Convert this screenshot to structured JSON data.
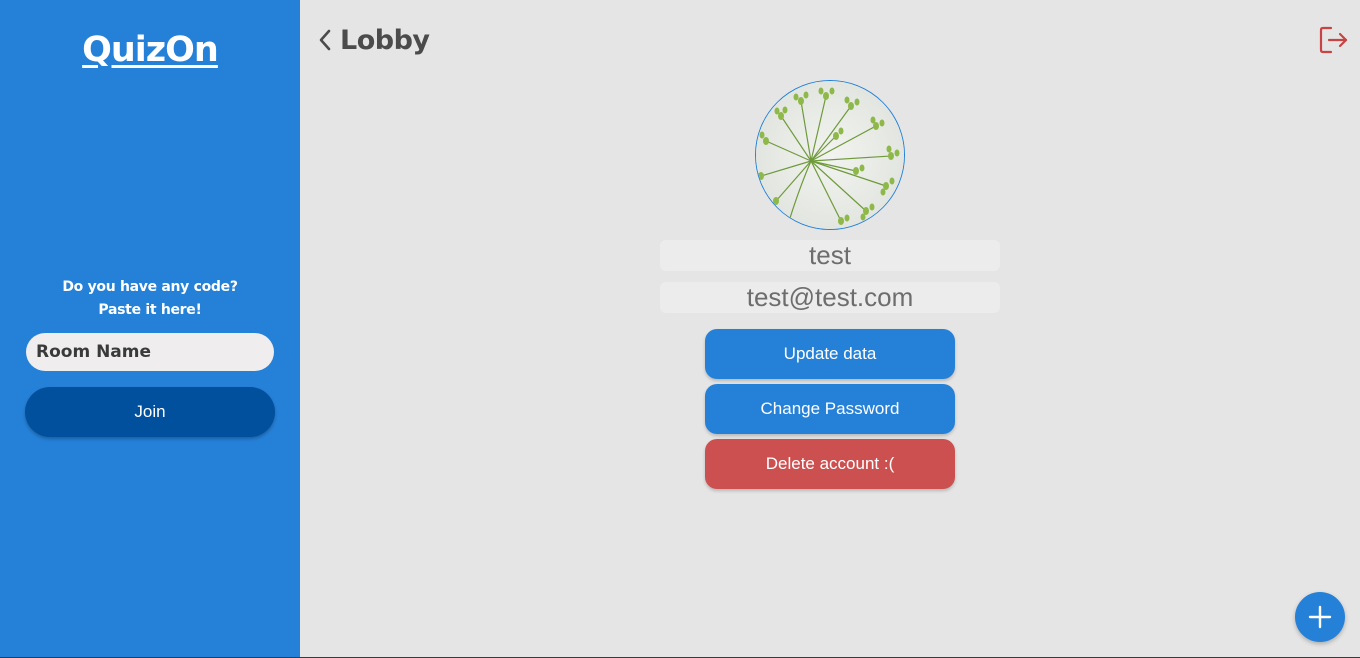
{
  "sidebar": {
    "logo": "QuizOn",
    "code_prompt_line1": "Do you have any code?",
    "code_prompt_line2": "Paste it here!",
    "room_input_placeholder": "Room Name",
    "join_label": "Join"
  },
  "header": {
    "back_label": "Lobby",
    "back_icon": "chevron-left-icon",
    "logout_icon": "logout-icon"
  },
  "profile": {
    "avatar": "profile-photo",
    "username": "test",
    "email": "test@test.com",
    "update_label": "Update data",
    "change_password_label": "Change Password",
    "delete_label": "Delete account :("
  },
  "fab": {
    "icon": "plus-icon"
  },
  "colors": {
    "primary": "#2581d8",
    "primary_dark": "#00509e",
    "danger": "#cd5050",
    "logout_icon": "#c84444",
    "background": "#e5e5e5"
  }
}
